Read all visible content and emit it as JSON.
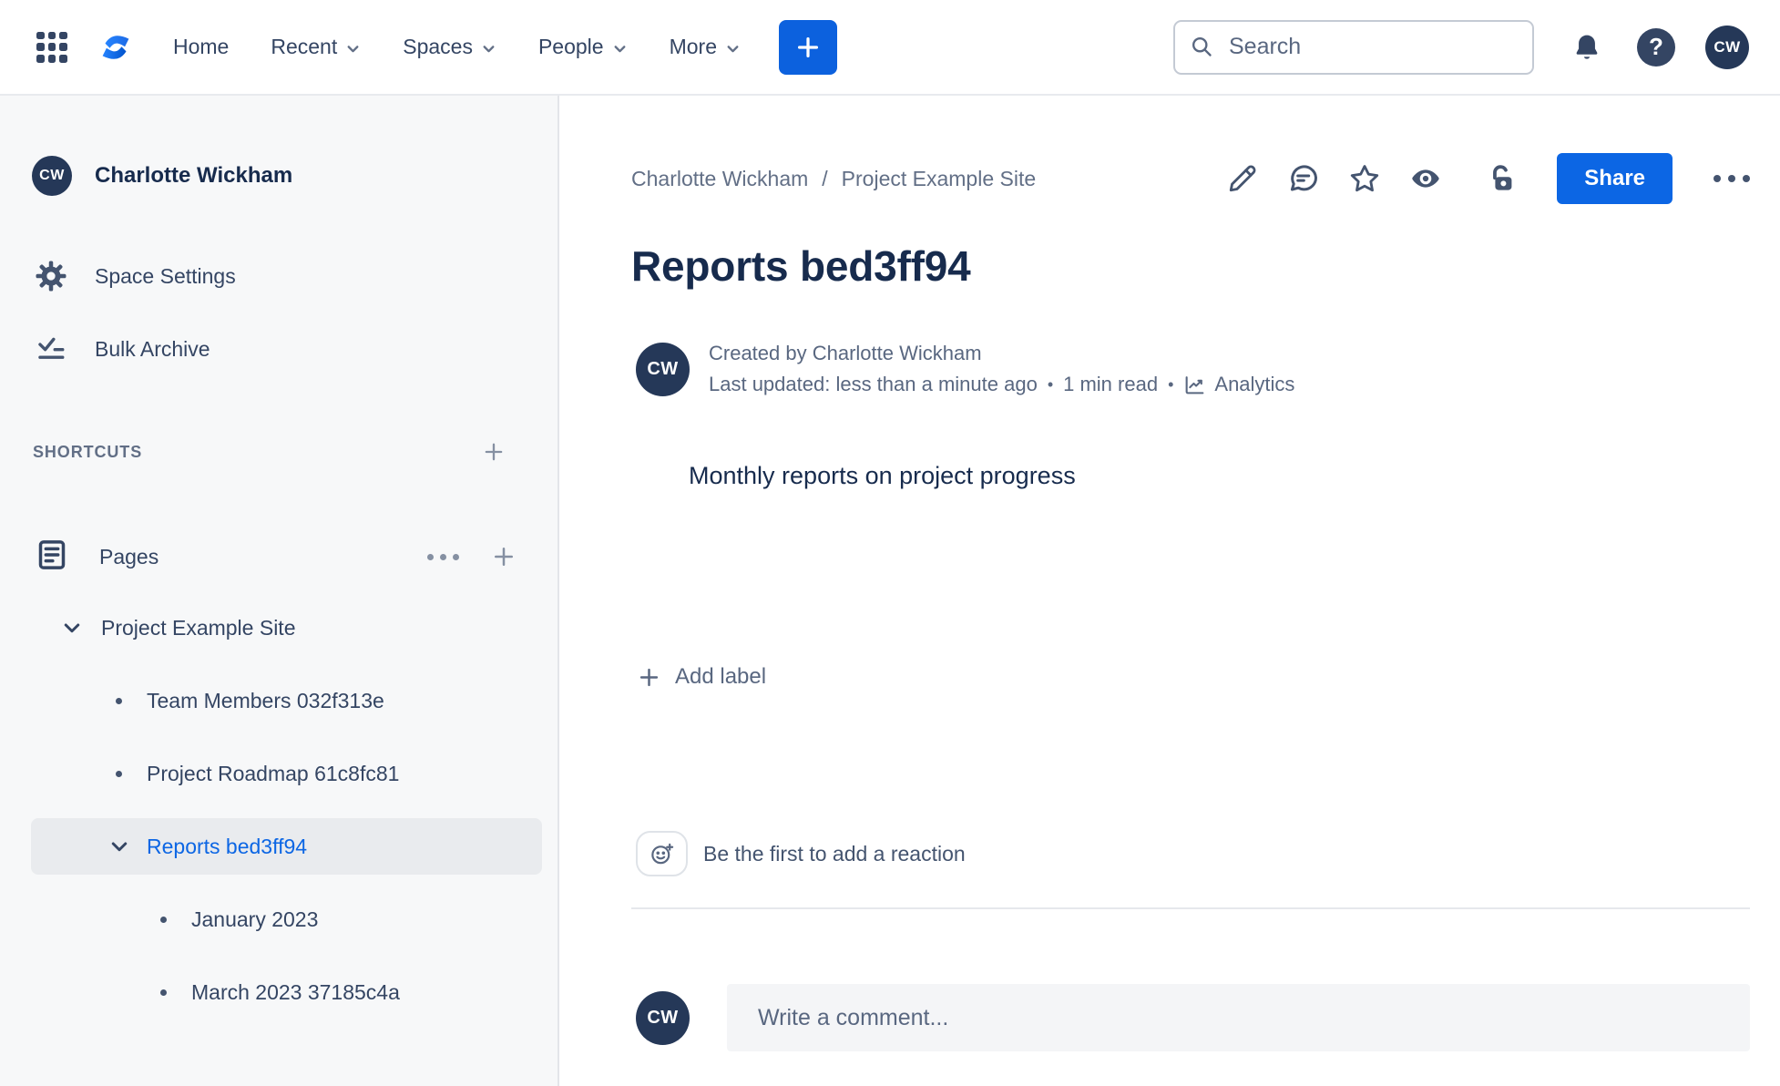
{
  "colors": {
    "accent_blue": "#0C66E4",
    "brand_logo_blue_light": "#2684FF",
    "brand_logo_blue_dark": "#0052CC",
    "heading_navy": "#172B4D",
    "icon_slate": "#44546F",
    "muted_gray": "#596780",
    "avatar_navy": "#253858",
    "sidebar_bg": "#F7F8F9",
    "selected_row_bg": "#E9EBEE"
  },
  "nav": {
    "links": [
      {
        "label": "Home"
      },
      {
        "label": "Recent"
      },
      {
        "label": "Spaces"
      },
      {
        "label": "People"
      },
      {
        "label": "More"
      }
    ],
    "search": {
      "placeholder": "Search"
    },
    "user_initials": "CW"
  },
  "sidebar": {
    "space": {
      "initials": "CW",
      "name": "Charlotte Wickham"
    },
    "menu": [
      {
        "label": "Space Settings"
      },
      {
        "label": "Bulk Archive"
      }
    ],
    "shortcuts_heading": "SHORTCUTS",
    "pages_heading": "Pages",
    "tree": [
      {
        "label": "Project Example Site"
      },
      {
        "label": "Team Members 032f313e"
      },
      {
        "label": "Project Roadmap 61c8fc81"
      },
      {
        "label": "Reports bed3ff94"
      },
      {
        "label": "January 2023"
      },
      {
        "label": "March 2023 37185c4a"
      }
    ]
  },
  "content": {
    "breadcrumb": {
      "crumbs": [
        "Charlotte Wickham",
        "Project Example Site"
      ],
      "separator": "/"
    },
    "share_button": "Share",
    "page_title": "Reports bed3ff94",
    "byline": {
      "initials": "CW",
      "created_line": "Created by Charlotte Wickham",
      "updated_line": "Last updated: less than a minute ago",
      "separator": "•",
      "read_time": "1 min read",
      "analytics_label": "Analytics"
    },
    "body_paragraph": "Monthly reports on project progress",
    "add_label_button": "Add label",
    "reaction_prompt": "Be the first to add a reaction",
    "comment": {
      "initials": "CW",
      "placeholder": "Write a comment..."
    }
  }
}
